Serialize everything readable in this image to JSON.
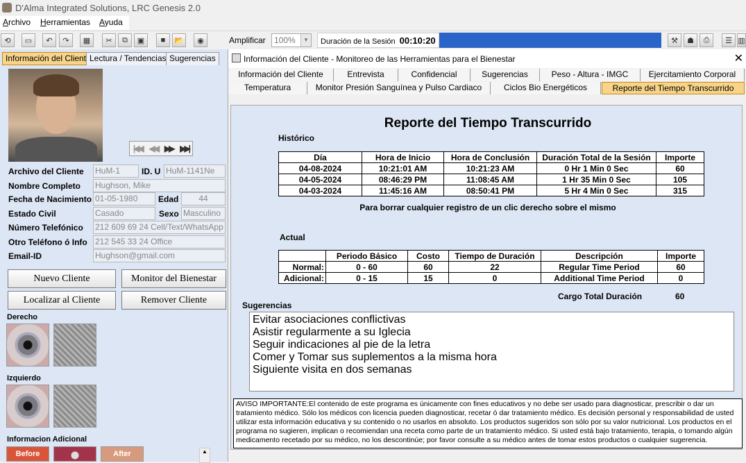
{
  "app": {
    "title": "D'Alma Integrated Solutions, LRC Genesis 2.0"
  },
  "menu": {
    "items": [
      "Archivo",
      "Herramientas",
      "Ayuda"
    ]
  },
  "toolbar": {
    "amplificar_label": "Amplificar",
    "zoom_value": "100%",
    "session_label": "Duración de la Sesión",
    "session_time": "00:10:20"
  },
  "left_panel": {
    "tabs": [
      "Información del Cliente",
      "Lectura / Tendencias",
      "Sugerencias"
    ],
    "fields": {
      "archivo_label": "Archivo del Cliente",
      "archivo_value": "HuM-1",
      "idu_label": "ID. U",
      "idu_value": "HuM-1141Ne",
      "nombre_label": "Nombre Completo",
      "nombre_value": "Hughson, Mike",
      "fecha_label": "Fecha de Nacimiento",
      "fecha_value": "01-05-1980",
      "edad_label": "Edad",
      "edad_value": "44",
      "estado_label": "Estado Civil",
      "estado_value": "Casado",
      "sexo_label": "Sexo",
      "sexo_value": "Masculino",
      "telefono_label": "Número Telefónico",
      "telefono_value": "212 609 69 24 Cell/Text/WhatsApp",
      "otro_label": "Otro Teléfono ó Info",
      "otro_value": "212 545 33 24 Office",
      "email_label": "Email-ID",
      "email_value": "Hughson@gmail.com"
    },
    "buttons": {
      "nuevo": "Nuevo Cliente",
      "monitor": "Monitor del Bienestar",
      "localizar": "Localizar al Cliente",
      "remover": "Remover Cliente"
    },
    "derecho_label": "Derecho",
    "izquierdo_label": "Izquierdo",
    "info_adicional_label": "Informacion Adicional",
    "thumbs": {
      "before": "Before",
      "after": "After"
    }
  },
  "main": {
    "window_title": "Información del Cliente - Monitoreo de las Herramientas para el Bienestar",
    "tabs_row1": [
      "Información del Cliente",
      "Entrevista",
      "Confidencial",
      "Sugerencias",
      "Peso - Altura - IMGC",
      "Ejercitamiento Corporal"
    ],
    "tabs_row2": [
      "Temperatura",
      "Monitor Presión Sanguínea y Pulso Cardiaco",
      "Ciclos Bio Energéticos",
      "Reporte del Tiempo Transcurrido"
    ],
    "report_title": "Reporte del Tiempo Transcurrido",
    "historico_label": "Histórico",
    "historico": {
      "headers": [
        "Día",
        "Hora de Inicio",
        "Hora de Conclusión",
        "Duración Total de la Sesión",
        "Importe"
      ],
      "rows": [
        [
          "04-08-2024",
          "10:21:01 AM",
          "10:21:23 AM",
          "0 Hr 1 Min 0 Sec",
          "60"
        ],
        [
          "04-05-2024",
          "08:46:29 PM",
          "11:08:45 AM",
          "1 Hr 35 Min 0 Sec",
          "105"
        ],
        [
          "04-03-2024",
          "11:45:16 AM",
          "08:50:41 PM",
          "5 Hr 4 Min 0 Sec",
          "315"
        ]
      ]
    },
    "borrar_note": "Para borrar cualquier registro de un clic derecho sobre el mismo",
    "actual_label": "Actual",
    "actual": {
      "headers": [
        "",
        "Periodo Básico",
        "Costo",
        "Tiempo de Duración",
        "Descripción",
        "Importe"
      ],
      "rows": [
        [
          "Normal:",
          "0 - 60",
          "60",
          "22",
          "Regular Time Period",
          "60"
        ],
        [
          "Adicional:",
          "0 - 15",
          "15",
          "0",
          "Additional Time Period",
          "0"
        ]
      ]
    },
    "cargo_label": "Cargo Total Duración",
    "cargo_value": "60",
    "sugerencias_label": "Sugerencias",
    "sugerencias": [
      "Evitar asociaciones conflictivas",
      "Asistir regularmente a su Iglecia",
      "Seguir indicaciones al pie de la letra",
      "Comer y Tomar sus suplementos a la misma hora",
      "Siguiente visita en dos semanas"
    ],
    "aviso": "AVISO IMPORTANTE:El contenido de este programa es únicamente con fines educativos y no debe ser usado para diagnosticar, prescribir o dar un tratamiento médico. Sólo los médicos con licencia pueden diagnosticar, recetar ó dar tratamiento médico. Es decisión personal y responsabilidad de usted utilizar esta información educativa y su contenido o no usarlos en absoluto. Los productos sugeridos son sólo por su valor nutricional. Los productos en el programa no sugieren, implican o recomiendan una receta como parte de un tratamiento médico. Si usted está bajo tratamiento, terapia, o tomando algún medicamento recetado por su médico, no los descontinúe; por favor consulte a su médico antes de tomar estos productos o cualquier sugerencia."
  }
}
